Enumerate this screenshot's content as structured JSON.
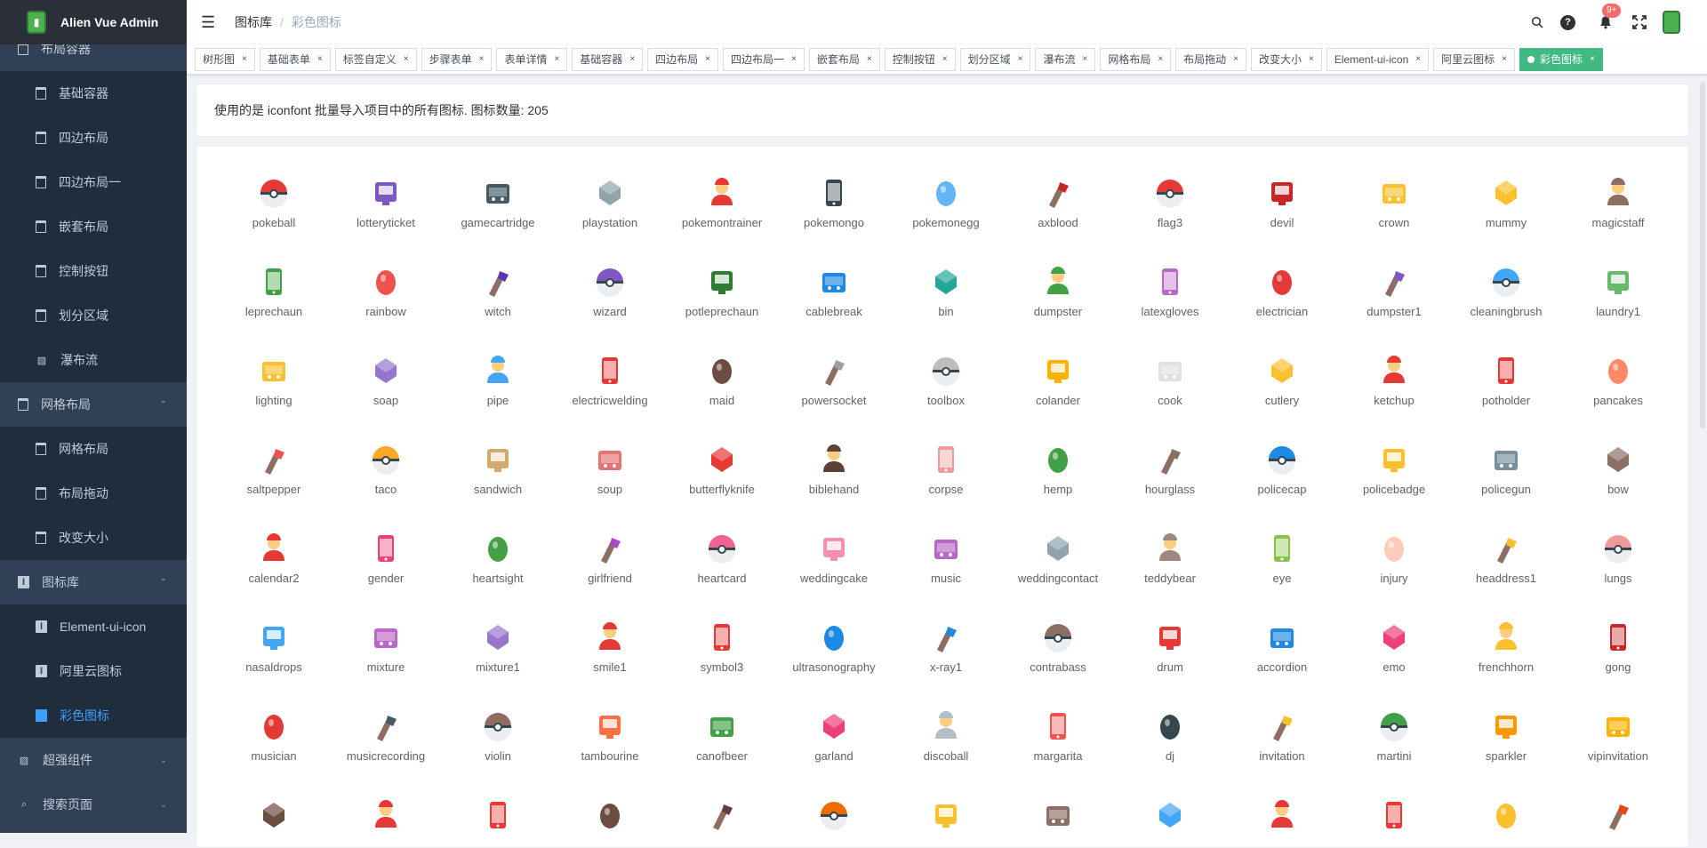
{
  "app": {
    "title": "Alien Vue Admin"
  },
  "sidebar": {
    "items": [
      {
        "label": "布局容器",
        "type": "group",
        "icon": "page-icon"
      },
      {
        "label": "基础容器",
        "type": "sub",
        "icon": "page-icon"
      },
      {
        "label": "四边布局",
        "type": "sub",
        "icon": "page-icon"
      },
      {
        "label": "四边布局一",
        "type": "sub",
        "icon": "page-icon"
      },
      {
        "label": "嵌套布局",
        "type": "sub",
        "icon": "page-icon"
      },
      {
        "label": "控制按钮",
        "type": "sub",
        "icon": "page-icon"
      },
      {
        "label": "划分区域",
        "type": "sub",
        "icon": "page-icon"
      },
      {
        "label": "瀑布流",
        "type": "sub",
        "icon": "image-icon"
      },
      {
        "label": "网格布局",
        "type": "group",
        "icon": "page-icon",
        "arrow": "⌃"
      },
      {
        "label": "网格布局",
        "type": "sub",
        "icon": "page-icon"
      },
      {
        "label": "布局拖动",
        "type": "sub",
        "icon": "page-icon"
      },
      {
        "label": "改变大小",
        "type": "sub",
        "icon": "page-icon"
      },
      {
        "label": "图标库",
        "type": "group",
        "icon": "icon-lib-icon",
        "arrow": "⌃"
      },
      {
        "label": "Element-ui-icon",
        "type": "sub",
        "icon": "icon-lib-icon"
      },
      {
        "label": "阿里云图标",
        "type": "sub",
        "icon": "icon-lib-icon"
      },
      {
        "label": "彩色图标",
        "type": "sub",
        "icon": "icon-lib-icon",
        "active": true
      },
      {
        "label": "超强组件",
        "type": "group",
        "icon": "image-icon",
        "arrow": "⌄"
      },
      {
        "label": "搜索页面",
        "type": "group",
        "icon": "search-icon",
        "arrow": "⌄"
      }
    ]
  },
  "header": {
    "breadcrumb": [
      "图标库",
      "彩色图标"
    ],
    "separator": "/",
    "notification_badge": "9+",
    "icons": [
      "search-icon",
      "help-icon",
      "bell-icon",
      "fullscreen-icon",
      "avatar"
    ]
  },
  "tags": [
    {
      "label": "树形图"
    },
    {
      "label": "基础表单"
    },
    {
      "label": "标签自定义"
    },
    {
      "label": "步骤表单"
    },
    {
      "label": "表单详情"
    },
    {
      "label": "基础容器"
    },
    {
      "label": "四边布局"
    },
    {
      "label": "四边布局一"
    },
    {
      "label": "嵌套布局"
    },
    {
      "label": "控制按钮"
    },
    {
      "label": "划分区域"
    },
    {
      "label": "瀑布流"
    },
    {
      "label": "网格布局"
    },
    {
      "label": "布局拖动"
    },
    {
      "label": "改变大小"
    },
    {
      "label": "Element-ui-icon"
    },
    {
      "label": "阿里云图标"
    },
    {
      "label": "彩色图标",
      "active": true
    }
  ],
  "tag_close": "×",
  "info": {
    "text": "使用的是 iconfont 批量导入项目中的所有图标. 图标数量: 205"
  },
  "icons": [
    {
      "name": "pokeball",
      "color": "#e53935"
    },
    {
      "name": "lotteryticket",
      "color": "#7e57c2"
    },
    {
      "name": "gamecartridge",
      "color": "#455a64"
    },
    {
      "name": "playstation",
      "color": "#90a4ae"
    },
    {
      "name": "pokemontrainer",
      "color": "#e53935"
    },
    {
      "name": "pokemongo",
      "color": "#37474f"
    },
    {
      "name": "pokemonegg",
      "color": "#64b5f6"
    },
    {
      "name": "axblood",
      "color": "#c62828"
    },
    {
      "name": "flag3",
      "color": "#e53935"
    },
    {
      "name": "devil",
      "color": "#c62828"
    },
    {
      "name": "crown",
      "color": "#fbc02d"
    },
    {
      "name": "mummy",
      "color": "#fbc02d"
    },
    {
      "name": "magicstaff",
      "color": "#8d6e63"
    },
    {
      "name": "leprechaun",
      "color": "#43a047"
    },
    {
      "name": "rainbow",
      "color": "#ef5350"
    },
    {
      "name": "witch",
      "color": "#5e35b1"
    },
    {
      "name": "wizard",
      "color": "#7e57c2"
    },
    {
      "name": "potleprechaun",
      "color": "#2e7d32"
    },
    {
      "name": "cablebreak",
      "color": "#1e88e5"
    },
    {
      "name": "bin",
      "color": "#26a69a"
    },
    {
      "name": "dumpster",
      "color": "#43a047"
    },
    {
      "name": "latexgloves",
      "color": "#ba68c8"
    },
    {
      "name": "electrician",
      "color": "#e53935"
    },
    {
      "name": "dumpster1",
      "color": "#7e57c2"
    },
    {
      "name": "cleaningbrush",
      "color": "#42a5f5"
    },
    {
      "name": "laundry1",
      "color": "#66bb6a"
    },
    {
      "name": "lighting",
      "color": "#fbc02d"
    },
    {
      "name": "soap",
      "color": "#9575cd"
    },
    {
      "name": "pipe",
      "color": "#42a5f5"
    },
    {
      "name": "electricwelding",
      "color": "#e53935"
    },
    {
      "name": "maid",
      "color": "#6d4c41"
    },
    {
      "name": "powersocket",
      "color": "#9e9e9e"
    },
    {
      "name": "toolbox",
      "color": "#bdbdbd"
    },
    {
      "name": "colander",
      "color": "#ffb300"
    },
    {
      "name": "cook",
      "color": "#e0e0e0"
    },
    {
      "name": "cutlery",
      "color": "#fbc02d"
    },
    {
      "name": "ketchup",
      "color": "#e53935"
    },
    {
      "name": "potholder",
      "color": "#e53935"
    },
    {
      "name": "pancakes",
      "color": "#ff8a65"
    },
    {
      "name": "saltpepper",
      "color": "#ef5350"
    },
    {
      "name": "taco",
      "color": "#ffa726"
    },
    {
      "name": "sandwich",
      "color": "#d7a86e"
    },
    {
      "name": "soup",
      "color": "#e57373"
    },
    {
      "name": "butterflyknife",
      "color": "#e53935"
    },
    {
      "name": "biblehand",
      "color": "#5d4037"
    },
    {
      "name": "corpse",
      "color": "#ef9a9a"
    },
    {
      "name": "hemp",
      "color": "#43a047"
    },
    {
      "name": "hourglass",
      "color": "#8d6e63"
    },
    {
      "name": "policecap",
      "color": "#1e88e5"
    },
    {
      "name": "policebadge",
      "color": "#fbc02d"
    },
    {
      "name": "policegun",
      "color": "#78909c"
    },
    {
      "name": "bow",
      "color": "#8d6e63"
    },
    {
      "name": "calendar2",
      "color": "#e53935"
    },
    {
      "name": "gender",
      "color": "#ec407a"
    },
    {
      "name": "heartsight",
      "color": "#43a047"
    },
    {
      "name": "girlfriend",
      "color": "#ab47bc"
    },
    {
      "name": "heartcard",
      "color": "#f06292"
    },
    {
      "name": "weddingcake",
      "color": "#f48fb1"
    },
    {
      "name": "music",
      "color": "#ba68c8"
    },
    {
      "name": "weddingcontact",
      "color": "#90a4ae"
    },
    {
      "name": "teddybear",
      "color": "#a1887f"
    },
    {
      "name": "eye",
      "color": "#8bc34a"
    },
    {
      "name": "injury",
      "color": "#ffccbc"
    },
    {
      "name": "headdress1",
      "color": "#fbc02d"
    },
    {
      "name": "lungs",
      "color": "#ef9a9a"
    },
    {
      "name": "nasaldrops",
      "color": "#42a5f5"
    },
    {
      "name": "mixture",
      "color": "#ba68c8"
    },
    {
      "name": "mixture1",
      "color": "#9575cd"
    },
    {
      "name": "smile1",
      "color": "#e53935"
    },
    {
      "name": "symbol3",
      "color": "#e53935"
    },
    {
      "name": "ultrasonography",
      "color": "#1e88e5"
    },
    {
      "name": "x-ray1",
      "color": "#1e88e5"
    },
    {
      "name": "contrabass",
      "color": "#8d6e63"
    },
    {
      "name": "drum",
      "color": "#e53935"
    },
    {
      "name": "accordion",
      "color": "#1e88e5"
    },
    {
      "name": "emo",
      "color": "#ec407a"
    },
    {
      "name": "frenchhorn",
      "color": "#fbc02d"
    },
    {
      "name": "gong",
      "color": "#c62828"
    },
    {
      "name": "musician",
      "color": "#e53935"
    },
    {
      "name": "musicrecording",
      "color": "#455a64"
    },
    {
      "name": "violin",
      "color": "#8d6e63"
    },
    {
      "name": "tambourine",
      "color": "#ff7043"
    },
    {
      "name": "canofbeer",
      "color": "#43a047"
    },
    {
      "name": "garland",
      "color": "#ec407a"
    },
    {
      "name": "discoball",
      "color": "#b0bec5"
    },
    {
      "name": "margarita",
      "color": "#ef5350"
    },
    {
      "name": "dj",
      "color": "#37474f"
    },
    {
      "name": "invitation",
      "color": "#fbc02d"
    },
    {
      "name": "martini",
      "color": "#43a047"
    },
    {
      "name": "sparkler",
      "color": "#ff9800"
    },
    {
      "name": "vipinvitation",
      "color": "#ffb300"
    },
    {
      "name": "",
      "color": "#6d4c41"
    },
    {
      "name": "",
      "color": "#e53935"
    },
    {
      "name": "",
      "color": "#e53935"
    },
    {
      "name": "",
      "color": "#6d4c41"
    },
    {
      "name": "",
      "color": "#5d4037"
    },
    {
      "name": "",
      "color": "#ef6c00"
    },
    {
      "name": "",
      "color": "#fbc02d"
    },
    {
      "name": "",
      "color": "#8d6e63"
    },
    {
      "name": "",
      "color": "#42a5f5"
    },
    {
      "name": "",
      "color": "#e53935"
    },
    {
      "name": "",
      "color": "#e53935"
    },
    {
      "name": "",
      "color": "#fbc02d"
    },
    {
      "name": "",
      "color": "#e64a19"
    }
  ]
}
